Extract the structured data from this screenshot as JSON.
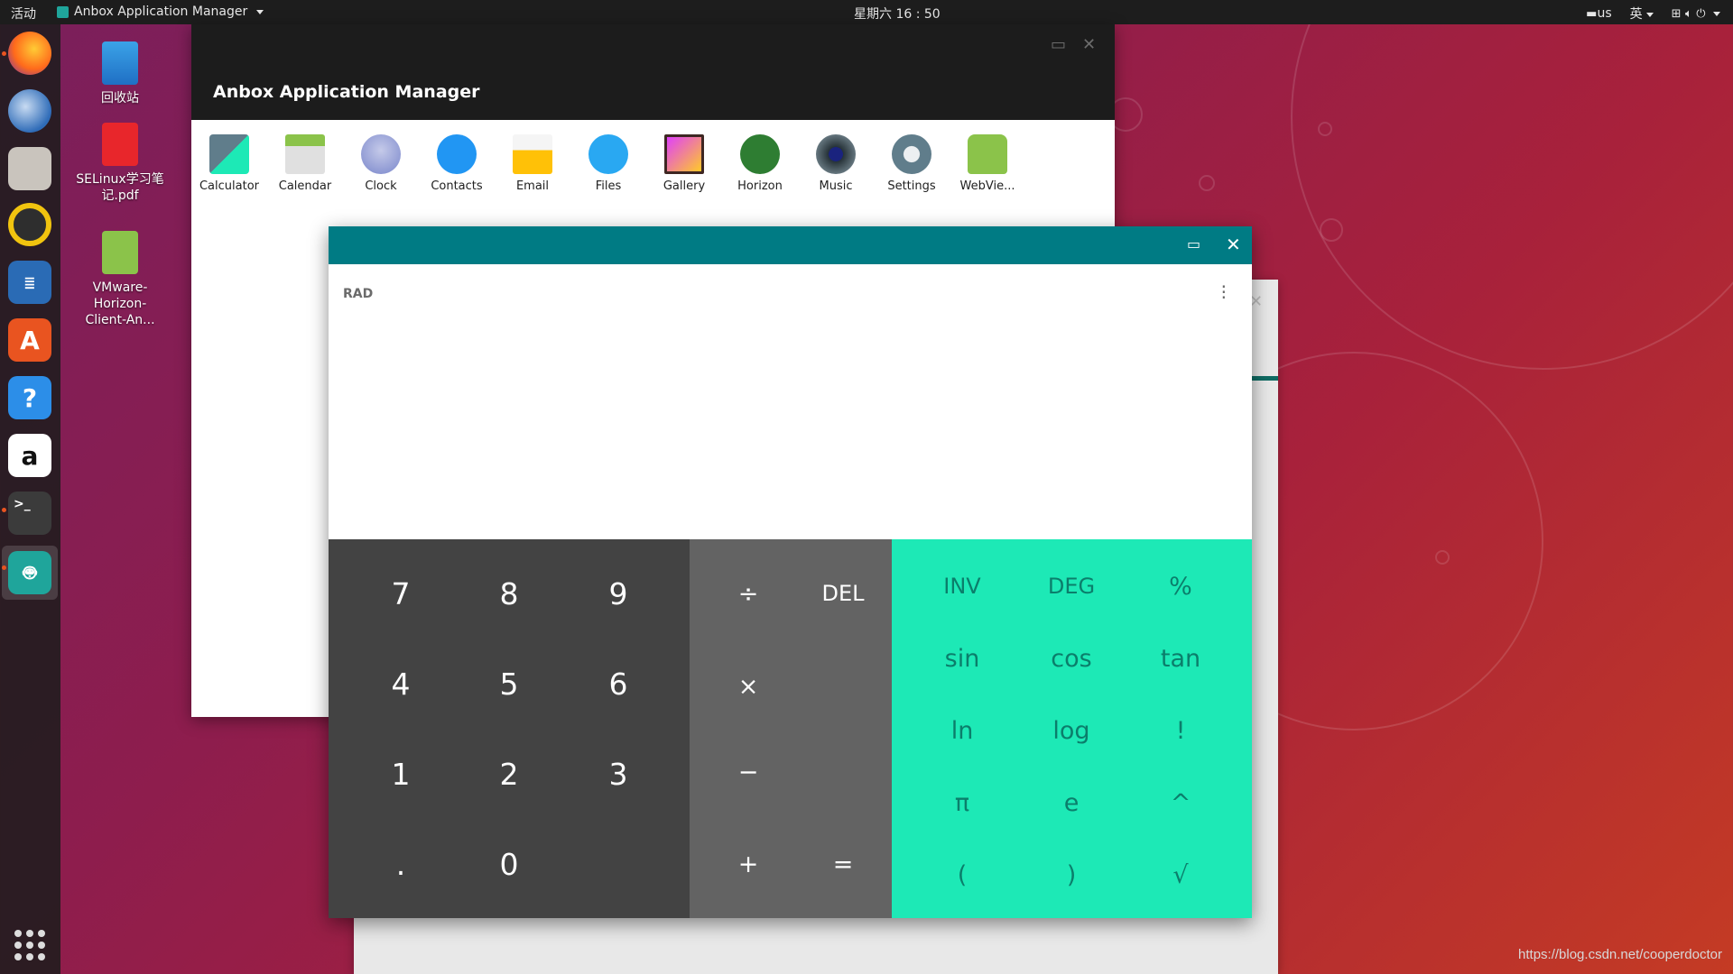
{
  "topbar": {
    "activities": "活动",
    "app_menu": "Anbox Application Manager",
    "clock": "星期六 16 : 50",
    "keyboard": "us",
    "input_method": "英"
  },
  "desktop": {
    "icons": [
      {
        "label": "回收站"
      },
      {
        "label": "SELinux学习笔记.pdf"
      },
      {
        "label": "VMware-Horizon-Client-An..."
      }
    ]
  },
  "manager": {
    "title": "Anbox Application Manager",
    "apps": [
      {
        "label": "Calculator"
      },
      {
        "label": "Calendar"
      },
      {
        "label": "Clock"
      },
      {
        "label": "Contacts"
      },
      {
        "label": "Email"
      },
      {
        "label": "Files"
      },
      {
        "label": "Gallery"
      },
      {
        "label": "Horizon"
      },
      {
        "label": "Music"
      },
      {
        "label": "Settings"
      },
      {
        "label": "WebVie..."
      }
    ]
  },
  "calculator": {
    "mode": "RAD",
    "numeric_keys": [
      "7",
      "8",
      "9",
      "4",
      "5",
      "6",
      "1",
      "2",
      "3",
      ".",
      "0"
    ],
    "operator_keys": [
      "÷",
      "DEL",
      "×",
      "−",
      "+",
      "="
    ],
    "advanced_keys": [
      "INV",
      "DEG",
      "%",
      "sin",
      "cos",
      "tan",
      "ln",
      "log",
      "!",
      "π",
      "e",
      "^",
      "(",
      ")",
      "√"
    ]
  },
  "watermark": "https://blog.csdn.net/cooperdoctor",
  "colors": {
    "titlebar": "#007b84",
    "advanced_pad": "#1de9b6",
    "numeric_pad": "#434343",
    "operator_pad": "#636363"
  }
}
